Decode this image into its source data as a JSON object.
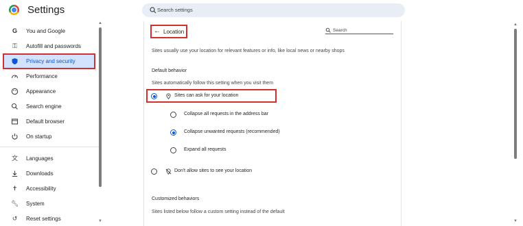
{
  "header": {
    "app_title": "Settings",
    "search_placeholder": "Search settings"
  },
  "sidebar": {
    "items": [
      {
        "label": "You and Google",
        "icon": "google-g-icon"
      },
      {
        "label": "Autofill and passwords",
        "icon": "key-icon"
      },
      {
        "label": "Privacy and security",
        "icon": "shield-icon",
        "active": true
      },
      {
        "label": "Performance",
        "icon": "speedometer-icon"
      },
      {
        "label": "Appearance",
        "icon": "palette-icon"
      },
      {
        "label": "Search engine",
        "icon": "search-icon"
      },
      {
        "label": "Default browser",
        "icon": "browser-window-icon"
      },
      {
        "label": "On startup",
        "icon": "power-icon"
      },
      {
        "label": "Languages",
        "icon": "translate-icon"
      },
      {
        "label": "Downloads",
        "icon": "download-icon"
      },
      {
        "label": "Accessibility",
        "icon": "accessibility-icon"
      },
      {
        "label": "System",
        "icon": "wrench-icon"
      },
      {
        "label": "Reset settings",
        "icon": "reset-icon"
      }
    ]
  },
  "main": {
    "page_title": "Location",
    "search_placeholder": "Search",
    "description": "Sites usually use your location for relevant features or info, like local news or nearby shops",
    "default_behavior_heading": "Default behavior",
    "default_behavior_subtext": "Sites automatically follow this setting when you visit them",
    "options": {
      "allow_ask": "Sites can ask for your location",
      "collapse_all": "Collapse all requests in the address bar",
      "collapse_unwanted": "Collapse unwanted requests (recommended)",
      "expand_all": "Expand all requests",
      "block": "Don't allow sites to see your location"
    },
    "customized_heading": "Customized behaviors",
    "customized_subtext": "Sites listed below follow a custom setting instead of the default"
  },
  "colors": {
    "accent": "#0b57d0",
    "highlight_box": "#d32f2f",
    "active_nav_bg": "#d3e3fd"
  }
}
